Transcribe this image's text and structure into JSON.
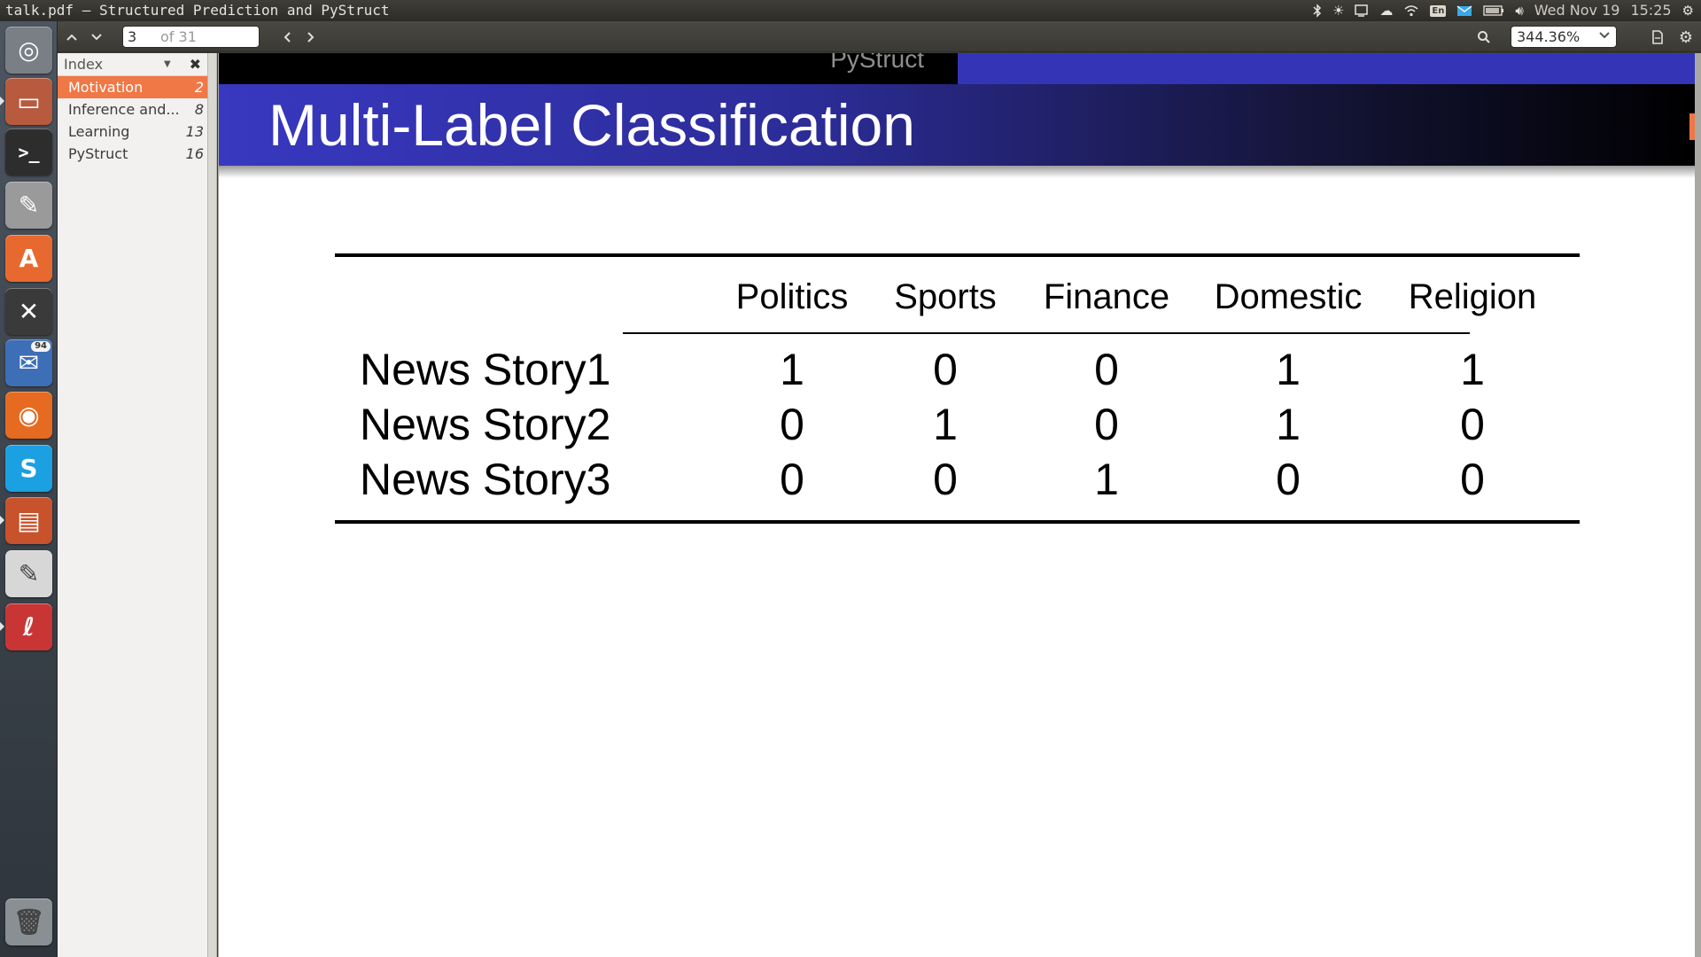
{
  "window": {
    "title": "talk.pdf — Structured Prediction and PyStruct"
  },
  "panel": {
    "keyboard_layout": "En",
    "date": "Wed Nov 19",
    "time": "15:25",
    "icons": [
      "bluetooth-icon",
      "brightness-icon",
      "display-icon",
      "cloud-icon",
      "wifi-icon",
      "keyboard-icon",
      "mail-icon",
      "battery-icon",
      "volume-icon",
      "settings-icon"
    ]
  },
  "launcher": {
    "items": [
      {
        "name": "dash",
        "icon": "ubuntu-logo-icon",
        "color": "#7a7f86"
      },
      {
        "name": "files",
        "icon": "file-cabinet-icon",
        "color": "#b85a3e"
      },
      {
        "name": "terminal",
        "icon": "terminal-icon",
        "color": "#2d2d2d"
      },
      {
        "name": "system-settings",
        "icon": "settings-tools-icon",
        "color": "#9a9a9a"
      },
      {
        "name": "software-center",
        "icon": "shopping-bag-icon",
        "color": "#e8692f"
      },
      {
        "name": "xchat",
        "icon": "xchat-icon",
        "color": "#3a3a3a",
        "glyph": "✕"
      },
      {
        "name": "thunderbird",
        "icon": "thunderbird-icon",
        "color": "#3d6fb6",
        "badge": "94"
      },
      {
        "name": "firefox",
        "icon": "firefox-icon",
        "color": "#e66a20"
      },
      {
        "name": "skype",
        "icon": "skype-icon",
        "color": "#1ba0e1",
        "glyph": "S"
      },
      {
        "name": "impress",
        "icon": "presentation-icon",
        "color": "#c8522b"
      },
      {
        "name": "text-editor",
        "icon": "text-editor-icon",
        "color": "#d7d7d7"
      },
      {
        "name": "pdf-viewer",
        "icon": "pdf-viewer-icon",
        "color": "#c93535"
      },
      {
        "name": "trash",
        "icon": "trash-icon",
        "color": "#8a8f94"
      }
    ]
  },
  "toolbar": {
    "page_number": "3",
    "page_of": "of 31",
    "zoom": "344.36%"
  },
  "sidebar": {
    "header": "Index",
    "items": [
      {
        "label": "Motivation",
        "page": "2",
        "active": true
      },
      {
        "label": "Inference and...",
        "page": "8",
        "active": false
      },
      {
        "label": "Learning",
        "page": "13",
        "active": false
      },
      {
        "label": "PyStruct",
        "page": "16",
        "active": false
      }
    ]
  },
  "slide": {
    "nav_section": "PyStruct",
    "title": "Multi-Label Classification",
    "table": {
      "columns": [
        "Politics",
        "Sports",
        "Finance",
        "Domestic",
        "Religion"
      ],
      "rows": [
        {
          "label": "News Story1",
          "values": [
            "1",
            "0",
            "0",
            "1",
            "1"
          ]
        },
        {
          "label": "News Story2",
          "values": [
            "0",
            "1",
            "0",
            "1",
            "0"
          ]
        },
        {
          "label": "News Story3",
          "values": [
            "0",
            "0",
            "1",
            "0",
            "0"
          ]
        }
      ]
    }
  }
}
